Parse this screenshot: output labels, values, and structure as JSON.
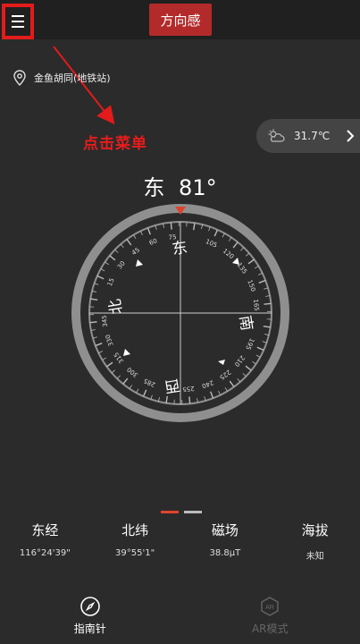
{
  "header": {
    "title": "方向感"
  },
  "location": {
    "name": "金鱼胡同(地铁站)"
  },
  "annotation": {
    "text": "点击菜单"
  },
  "weather": {
    "temperature": "31.7℃"
  },
  "heading": {
    "direction": "东",
    "degrees": "81°"
  },
  "compass": {
    "ticks": [
      "15",
      "30",
      "45",
      "60",
      "75",
      "105",
      "120",
      "135",
      "150",
      "165",
      "195",
      "210",
      "225",
      "240",
      "255",
      "285",
      "300",
      "315",
      "330",
      "345"
    ],
    "cardinals": {
      "east": "东",
      "south": "南",
      "west": "西",
      "north": "北"
    }
  },
  "stats": [
    {
      "label": "东经",
      "value": "116°24'39\""
    },
    {
      "label": "北纬",
      "value": "39°55'1\""
    },
    {
      "label": "磁场",
      "value": "38.8μT"
    },
    {
      "label": "海拔",
      "value": "未知"
    }
  ],
  "nav": [
    {
      "label": "指南针",
      "icon": "compass-icon",
      "active": true
    },
    {
      "label": "AR模式",
      "icon": "ar-icon",
      "badge": "AR",
      "active": false
    }
  ],
  "colors": {
    "accent": "#b32a2a",
    "highlight": "#e31b1b",
    "background": "#2b2b2b"
  }
}
